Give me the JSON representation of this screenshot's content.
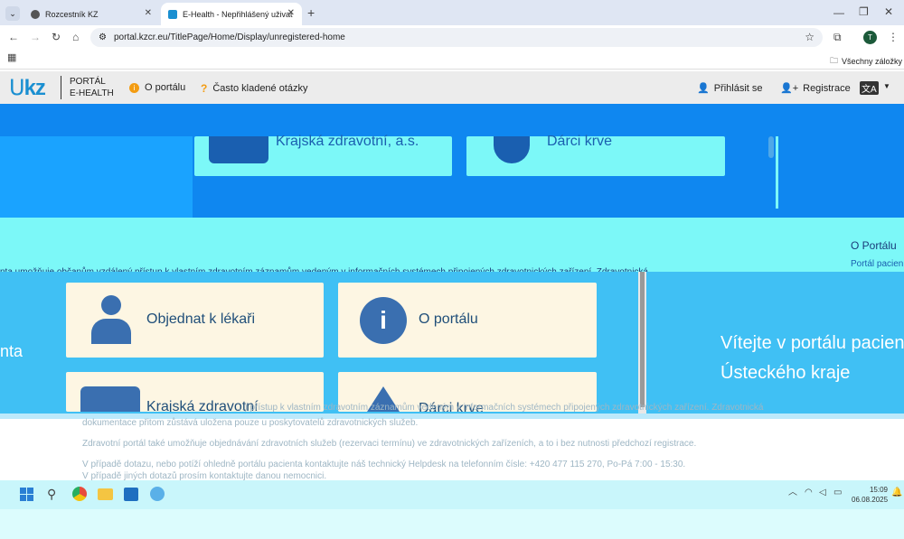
{
  "browser": {
    "tabs": [
      {
        "title": "Rozcestník KZ"
      },
      {
        "title": "E-Health - Nepřihlášený uživatel"
      }
    ],
    "url": "portal.kzcr.eu/TitlePage/Home/Display/unregistered-home",
    "bookmarks_label": "Všechny záložky",
    "profile_initial": "T"
  },
  "site": {
    "logo": "kz",
    "portal_line1": "PORTÁL",
    "portal_line2": "E-HEALTH",
    "nav": {
      "about": "O portálu",
      "faq": "Často kladené otázky"
    },
    "login": "Přihlásit se",
    "register": "Registrace",
    "lang": "文A"
  },
  "content": {
    "top_cards": [
      {
        "label": "Krajská zdravotní, a.s."
      },
      {
        "label": "Dárci krve"
      }
    ],
    "side_about_title": "O Portálu",
    "side_about_text": "Portál pacien",
    "intro_fragment": "nta umožňuje občanům vzdálený přístup k vlastním zdravotním záznamům vedeným v informačních systémech připojených zdravotnických zařízení. Zdravotnická",
    "cards": [
      {
        "label": "Objednat k lékaři"
      },
      {
        "label": "O portálu"
      },
      {
        "label": "Krajská zdravotní"
      },
      {
        "label": "Dárci krve"
      }
    ],
    "left_fragment": "nta",
    "welcome_line1": "Vítejte v portálu pacien",
    "welcome_line2": "Ústeckého kraje",
    "para1a": "...) přístup k vlastním zdravotním záznamům vedeným v informačních systémech připojených zdravotnických zařízení. Zdravotnická",
    "para1b": "dokumentace přitom zůstává uložena pouze u poskytovatelů zdravotnických služeb.",
    "para2": "Zdravotní portál také umožňuje objednávání zdravotních služeb (rezervaci termínu) ve zdravotnických zařízeních, a to i bez nutnosti předchozí registrace.",
    "para3": "V případě dotazu, nebo potíží ohledně portálu pacienta kontaktujte náš technický Helpdesk na telefonním čísle: +420 477 115 270, Po-Pá 7:00 - 15:30.",
    "para4": "V případě jiných dotazů prosím kontaktujte danou nemocnici."
  },
  "taskbar": {
    "time": "15:09",
    "date": "06.08.2025"
  },
  "colors": {
    "brand": "#1a8fd1",
    "cyan": "#7cf8f8",
    "blue": "#0f87f0",
    "sky": "#40c0f4",
    "card": "#fdf6e3"
  }
}
